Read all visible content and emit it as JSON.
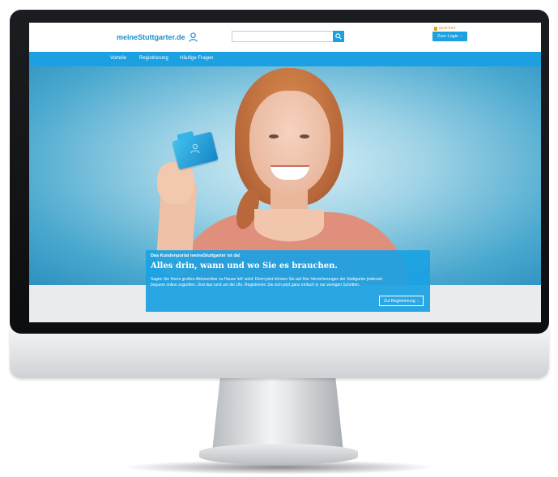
{
  "header": {
    "logo_text": "meineStuttgarter.de",
    "search": {
      "placeholder": "",
      "button_icon": "search-icon"
    },
    "lock_link": "gesichert",
    "login_button": "Zum Login"
  },
  "nav": {
    "items": [
      {
        "label": "Vorteile"
      },
      {
        "label": "Registrierung"
      },
      {
        "label": "Häufige Fragen"
      }
    ]
  },
  "hero": {
    "eyebrow": "Das Kundenportal meineStuttgarter ist da!",
    "headline": "Alles drin, wann und wo Sie es brauchen.",
    "body": "Sagen Sie Ihrem großen Aktenordner zu Hause leb' wohl: Denn jetzt können Sie auf Ihre Versicherungen der Stuttgarter jederzeit bequem online zugreifen. Und das rund um die Uhr. Registrieren Sie sich jetzt ganz einfach in nur wenigen Schritten.",
    "register_button": "Zur Registrierung"
  },
  "colors": {
    "brand_blue": "#1ba1e2",
    "accent_orange": "#e8a317"
  }
}
